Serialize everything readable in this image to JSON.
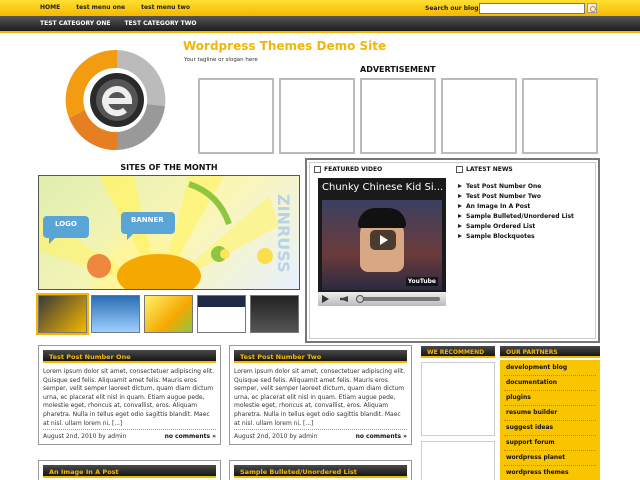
{
  "top_menu": [
    "HOME",
    "test menu one",
    "test menu two"
  ],
  "search": {
    "label": "Search our blog",
    "placeholder": ""
  },
  "category_menu": [
    "TEST CATEGORY ONE",
    "TEST CATEGORY TWO"
  ],
  "site": {
    "title": "Wordpress Themes Demo Site",
    "tagline": "Your tagline or slogan here"
  },
  "advertisement": {
    "label": "ADVERTISEMENT"
  },
  "sites_of_month": {
    "title": "SITES OF THE MONTH",
    "image_texts": [
      "LOGO",
      "BANNER",
      "ZINRUSS"
    ]
  },
  "featured_video": {
    "label": "FEATURED VIDEO",
    "title": "Chunky Chinese Kid Si...",
    "player_badge": "YouTube"
  },
  "latest_news": {
    "label": "LATEST NEWS",
    "items": [
      "Test Post Number One",
      "Test Post Number Two",
      "An Image In A Post",
      "Sample Bulleted/Unordered List",
      "Sample Ordered List",
      "Sample Blockquotes"
    ]
  },
  "posts": [
    {
      "title": "Test Post Number One",
      "excerpt": "Lorem ipsum dolor sit amet, consectetuer adipiscing elit. Quisque sed felis. Aliquamit amet felis. Mauris eros semper, velit semper laoreet dictum, quam diam dictum urna, ec placerat elit nisl in quam. Etiam augue pede, molestie eget, rhoncus at, convallist, eros. Aliquam pharetra. Nulla in tellus eget odio sagittis blandit. Maec at nisl. ullam lorem ni, [...]",
      "date": "August 2nd, 2010 by admin",
      "comments": "no comments »"
    },
    {
      "title": "Test Post Number Two",
      "excerpt": "Lorem ipsum dolor sit amet, consectetuer adipiscing elit. Quisque sed felis. Aliquamit amet felis. Mauris eros semper, velit semper laoreet dictum, quam diam dictum urna, ec placerat elit nisl in quam. Etiam augue pede, molestie eget, rhoncus at, convallist, eros. Aliquam pharetra. Nulla in tellus eget odio sagittis blandit. Maec at nisl. ullam lorem ni, [...]",
      "date": "August 2nd, 2010 by admin",
      "comments": "no comments »"
    },
    {
      "title": "An Image In A Post"
    },
    {
      "title": "Sample Bulleted/Unordered List"
    }
  ],
  "we_recommend": {
    "label": "WE RECOMMEND"
  },
  "partners": {
    "label": "OUR PARTNERS",
    "items": [
      "development blog",
      "documentation",
      "plugins",
      "resume builder",
      "suggest ideas",
      "support forum",
      "wordpress planet",
      "wordpress themes"
    ]
  },
  "colors": {
    "accent": "#f5b800",
    "dark": "#1c1c1c",
    "title": "#f2b705"
  }
}
